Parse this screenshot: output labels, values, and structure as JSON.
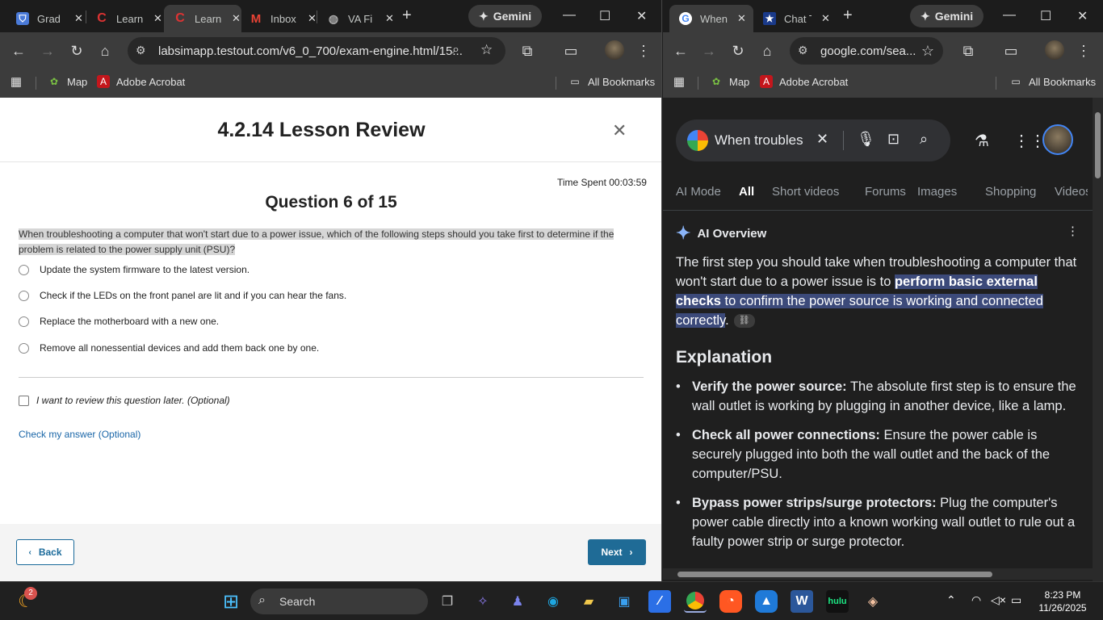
{
  "left": {
    "tabs": [
      {
        "title": "Grad",
        "icon": "shield-icon",
        "color": "#4a7ad8"
      },
      {
        "title": "Learn",
        "icon": "c-logo-icon",
        "color": "#d33"
      },
      {
        "title": "Learn",
        "icon": "c-logo-icon",
        "color": "#d33"
      },
      {
        "title": "Inbox",
        "icon": "gmail-icon",
        "color": "#ea4335"
      },
      {
        "title": "VA Fi",
        "icon": "globe-icon",
        "color": "#999"
      }
    ],
    "gemini_label": "Gemini",
    "url": "labsimapp.testout.com/v6_0_700/exam-engine.html/15...",
    "bookmarks": [
      "Map",
      "Adobe Acrobat"
    ],
    "all_bookmarks": "All Bookmarks",
    "header_title": "4.2.14 Lesson Review",
    "time_spent": "Time Spent 00:03:59",
    "question_number": "Question 6 of 15",
    "question_text": "When troubleshooting a computer that won't start due to a power issue, which of the following steps should you take first to determine if the problem is related to the power supply unit (PSU)?",
    "options": [
      "Update the system firmware to the latest version.",
      "Check if the LEDs on the front panel are lit and if you can hear the fans.",
      "Replace the motherboard with a new one.",
      "Remove all nonessential devices and add them back one by one."
    ],
    "review_label": "I want to review this question later. (Optional)",
    "check_answer": "Check my answer (Optional)",
    "back_label": "Back",
    "next_label": "Next"
  },
  "right": {
    "tabs": [
      {
        "title": "When",
        "icon": "google-icon"
      },
      {
        "title": "Chat T",
        "icon": "star-icon"
      }
    ],
    "gemini_label": "Gemini",
    "url": "google.com/sea...",
    "bookmarks": [
      "Map",
      "Adobe Acrobat"
    ],
    "all_bookmarks": "All Bookmarks",
    "search_query": "When troubleshooting a computer",
    "search_tabs": [
      "AI Mode",
      "All",
      "Short videos",
      "Forums",
      "Images",
      "Shopping",
      "Videos"
    ],
    "active_tab": "All",
    "ai_overview": "AI Overview",
    "intro_plain": "The first step you should take when troubleshooting a computer that won't start due to a power issue is to ",
    "intro_hl_bold": "perform basic external checks",
    "intro_hl_rest": " to confirm the power source is working and connected correctly",
    "intro_end": ".",
    "explanation_heading": "Explanation",
    "bullets": [
      {
        "bold": "Verify the power source:",
        "text": " The absolute first step is to ensure the wall outlet is working by plugging in another device, like a lamp."
      },
      {
        "bold": "Check all power connections:",
        "text": " Ensure the power cable is securely plugged into both the wall outlet and the back of the computer/PSU."
      },
      {
        "bold": "Bypass power strips/surge protectors:",
        "text": " Plug the computer's power cable directly into a known working wall outlet to rule out a faulty power strip or surge protector."
      }
    ]
  },
  "taskbar": {
    "search_label": "Search",
    "time": "8:23 PM",
    "date": "11/26/2025",
    "badge": "2",
    "hulu": "hulu"
  }
}
